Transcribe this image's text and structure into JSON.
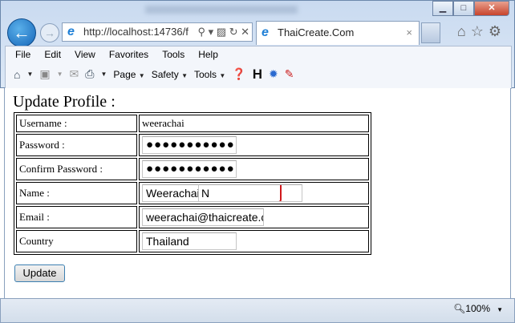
{
  "browser": {
    "address": "http://localhost:14736/f",
    "tab_title": "ThaiCreate.Com",
    "menu": [
      "File",
      "Edit",
      "View",
      "Favorites",
      "Tools",
      "Help"
    ],
    "commands": {
      "page": "Page",
      "safety": "Safety",
      "tools": "Tools"
    },
    "zoom": "100%"
  },
  "form": {
    "title": "Update Profile :",
    "rows": [
      {
        "label": "Username :",
        "value": "weerachai"
      },
      {
        "label": "Password :",
        "value": "●●●●●●●●●●●●"
      },
      {
        "label": "Confirm Password :",
        "value": "●●●●●●●●●●●●"
      },
      {
        "label": "Name :",
        "value": "Weerachai",
        "value2": "N"
      },
      {
        "label": "Email :",
        "value": "weerachai@thaicreate.cc"
      },
      {
        "label": "Country",
        "value": "Thailand"
      }
    ],
    "submit": "Update"
  },
  "colors": {
    "highlight": "#d0181c",
    "accent": "#1565b8"
  }
}
